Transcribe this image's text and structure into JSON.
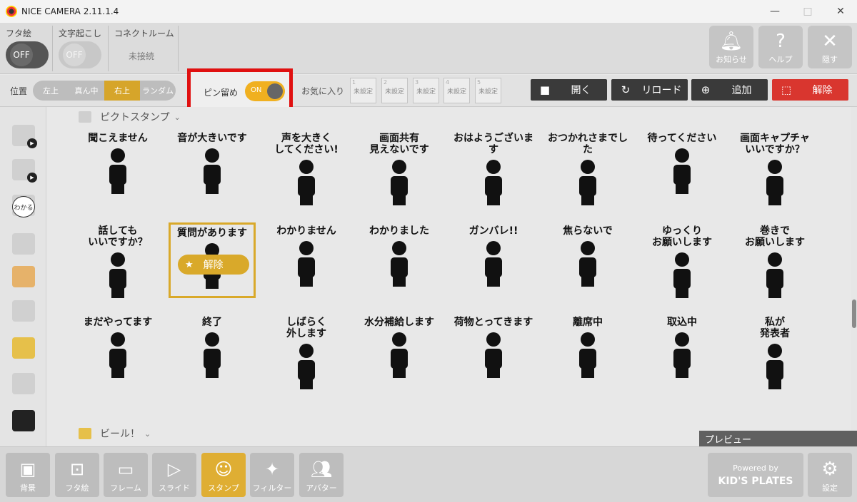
{
  "window": {
    "title": "NICE CAMERA 2.11.1.4",
    "minimize": "—",
    "maximize": "□",
    "close": "✕"
  },
  "header": {
    "futae": {
      "label": "フタ絵",
      "toggle": "OFF"
    },
    "caption": {
      "label": "文字起こし",
      "toggle": "OFF"
    },
    "connect": {
      "label": "コネクトルーム",
      "status": "未接続"
    },
    "notify": {
      "label": "お知らせ",
      "icon": "bell-icon"
    },
    "help": {
      "label": "ヘルプ",
      "icon": "question-icon"
    },
    "hide": {
      "label": "隠す",
      "icon": "close-icon"
    }
  },
  "toolbar": {
    "position_label": "位置",
    "positions": [
      "左上",
      "真ん中",
      "右上",
      "ランダム"
    ],
    "active_position": "右上",
    "pin_label": "ピン留め",
    "pin_state": "ON",
    "fav_label": "お気に入り",
    "fav_slots": [
      {
        "num": "1",
        "text": "未設定"
      },
      {
        "num": "2",
        "text": "未設定"
      },
      {
        "num": "3",
        "text": "未設定"
      },
      {
        "num": "4",
        "text": "未設定"
      },
      {
        "num": "5",
        "text": "未設定"
      }
    ],
    "open_label": "開く",
    "reload_label": "リロード",
    "add_label": "追加",
    "release_label": "解除"
  },
  "sidebar": {
    "items": [
      "",
      "",
      "",
      "わかる",
      "",
      "",
      "",
      "",
      "",
      ""
    ]
  },
  "sections": [
    {
      "title": "ピクトスタンプ",
      "chevron": "⌄"
    },
    {
      "title": "ビール！",
      "chevron": "⌄"
    }
  ],
  "stamps": [
    "聞こえません",
    "音が大きいです",
    "声を大きく\nしてください!",
    "画面共有\n見えないです",
    "おはようございます",
    "おつかれさまでした",
    "待ってください",
    "画面キャプチャ\nいいですか？",
    "話しても\nいいですか？",
    "質問があります",
    "わかりません",
    "わかりました",
    "ガンバレ!!",
    "焦らないで",
    "ゆっくり\nお願いします",
    "巻きで\nお願いします",
    "まだやってます",
    "終了",
    "しばらく\n外します",
    "水分補給します",
    "荷物とってきます",
    "離席中",
    "取込中",
    "私が\n発表者"
  ],
  "selected_stamp": {
    "index": 9,
    "unpin_label": "解除"
  },
  "preview_label": "プレビュー",
  "bottom": {
    "buttons": [
      {
        "label": "背景",
        "icon": "image-icon"
      },
      {
        "label": "フタ絵",
        "icon": "lid-icon"
      },
      {
        "label": "フレーム",
        "icon": "frame-icon"
      },
      {
        "label": "スライド",
        "icon": "play-icon"
      },
      {
        "label": "スタンプ",
        "icon": "smile-icon"
      },
      {
        "label": "フィルター",
        "icon": "filter-icon"
      },
      {
        "label": "アバター",
        "icon": "avatar-icon"
      }
    ],
    "active": "スタンプ",
    "powered_by": "Powered by",
    "brand": "KID'S PLATES",
    "settings": "設定"
  },
  "colors": {
    "accent": "#d9a92a",
    "highlight_red": "#e01010",
    "release_red": "#d9362f",
    "dark_button": "#3a3a3a"
  }
}
